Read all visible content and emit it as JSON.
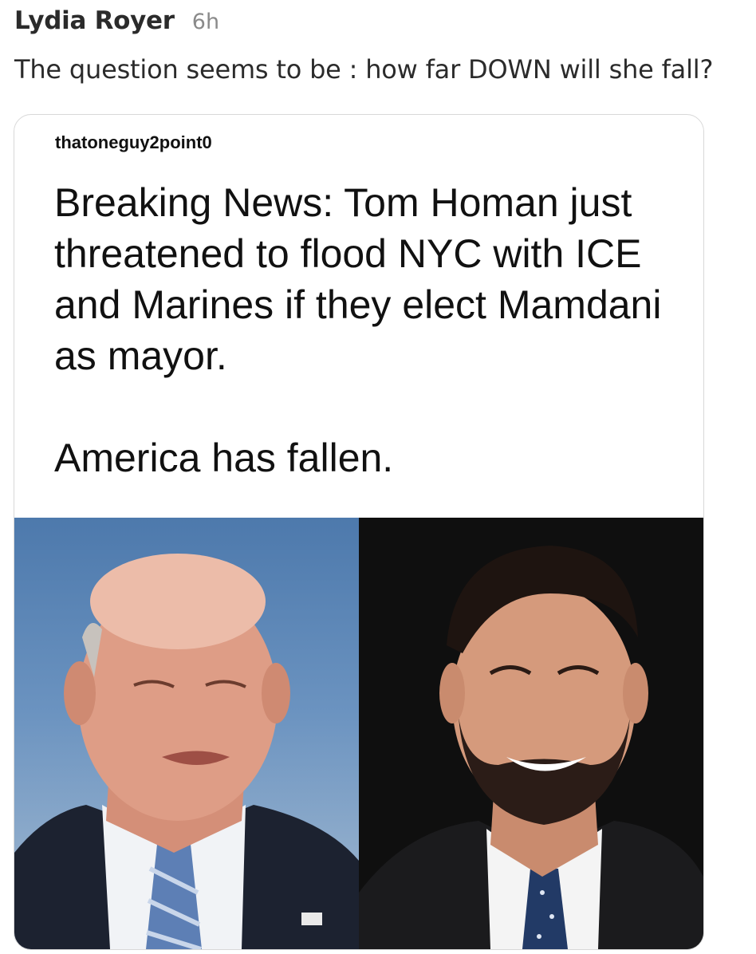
{
  "comment": {
    "author": "Lydia Royer",
    "time": "6h",
    "text": "The question seems to be : how far DOWN will she fall?"
  },
  "shared_post": {
    "username": "thatoneguy2point0",
    "paragraph1": "Breaking News: Tom Homan just threatened to flood NYC with ICE and Marines if they elect Mamdani as mayor.",
    "paragraph2": "America has fallen."
  }
}
